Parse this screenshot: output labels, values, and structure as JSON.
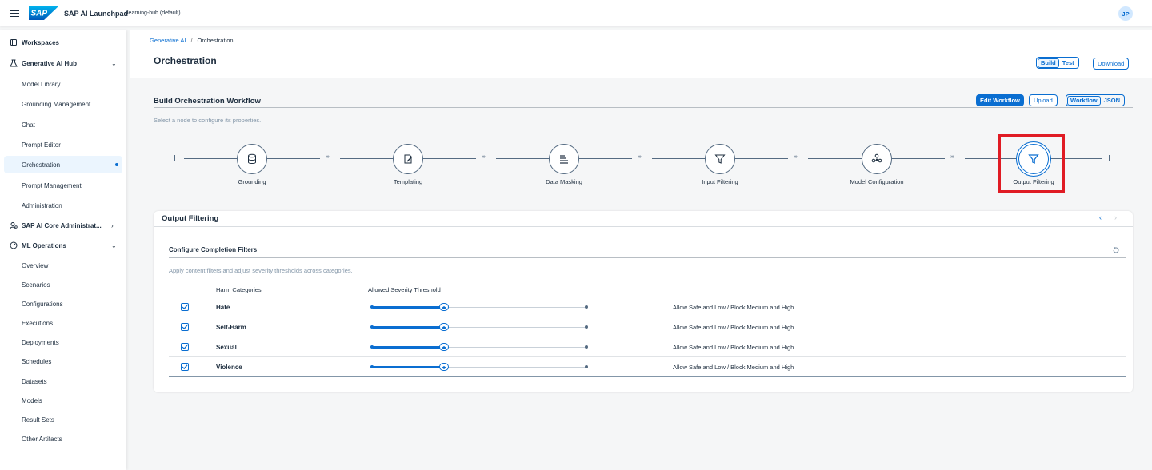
{
  "shell": {
    "app_title": "SAP AI Launchpad",
    "resource_group": "learning-hub (default)",
    "user_initials": "JP",
    "icons": [
      "menu-icon",
      "sap-logo"
    ]
  },
  "sidebar": {
    "groups": [
      {
        "label": "Workspaces",
        "icon": "workspaces-icon"
      },
      {
        "label": "Generative AI Hub",
        "icon": "flask-icon",
        "expanded": true,
        "items": [
          "Model Library",
          "Grounding Management",
          "Chat",
          "Prompt Editor",
          "Orchestration",
          "Prompt Management",
          "Administration"
        ]
      },
      {
        "label": "SAP AI Core Administrat...",
        "icon": "admin-icon",
        "expanded": false
      },
      {
        "label": "ML Operations",
        "icon": "ml-operations-icon",
        "expanded": true,
        "items": [
          "Overview",
          "Scenarios",
          "Configurations",
          "Executions",
          "Deployments",
          "Schedules",
          "Datasets",
          "Models",
          "Result Sets",
          "Other Artifacts"
        ]
      }
    ],
    "selected": "Orchestration"
  },
  "header": {
    "breadcrumb": [
      "Generative AI",
      "Orchestration"
    ],
    "title": "Orchestration",
    "mode_tabs": [
      "Build",
      "Test"
    ],
    "active_mode": "Build",
    "download_label": "Download"
  },
  "workflow": {
    "title": "Build Orchestration Workflow",
    "hint": "Select a node to configure its properties.",
    "edit_label": "Edit Workflow",
    "upload_label": "Upload",
    "view_tabs": [
      "Workflow",
      "JSON"
    ],
    "active_view": "Workflow",
    "nodes": [
      {
        "label": "Grounding",
        "icon": "database-icon"
      },
      {
        "label": "Templating",
        "icon": "edit-template-icon"
      },
      {
        "label": "Data Masking",
        "icon": "document-lines-icon"
      },
      {
        "label": "Input Filtering",
        "icon": "filter-icon"
      },
      {
        "label": "Model Configuration",
        "icon": "model-network-icon"
      },
      {
        "label": "Output Filtering",
        "icon": "filter-icon",
        "active": true
      }
    ]
  },
  "output_filtering": {
    "title": "Output Filtering",
    "subtitle": "Configure Completion Filters",
    "hint": "Apply content filters and adjust severity thresholds across categories.",
    "columns": [
      "Harm Categories",
      "Allowed Severity Threshold"
    ],
    "rows": [
      {
        "name": "Hate",
        "checked": true,
        "threshold_level": 0.33,
        "description": "Allow Safe and Low / Block Medium and High"
      },
      {
        "name": "Self-Harm",
        "checked": true,
        "threshold_level": 0.33,
        "description": "Allow Safe and Low / Block Medium and High"
      },
      {
        "name": "Sexual",
        "checked": true,
        "threshold_level": 0.33,
        "description": "Allow Safe and Low / Block Medium and High"
      },
      {
        "name": "Violence",
        "checked": true,
        "threshold_level": 0.33,
        "description": "Allow Safe and Low / Block Medium and High"
      }
    ]
  },
  "colors": {
    "accent": "#0a6ed1",
    "highlight": "#e01b24"
  }
}
